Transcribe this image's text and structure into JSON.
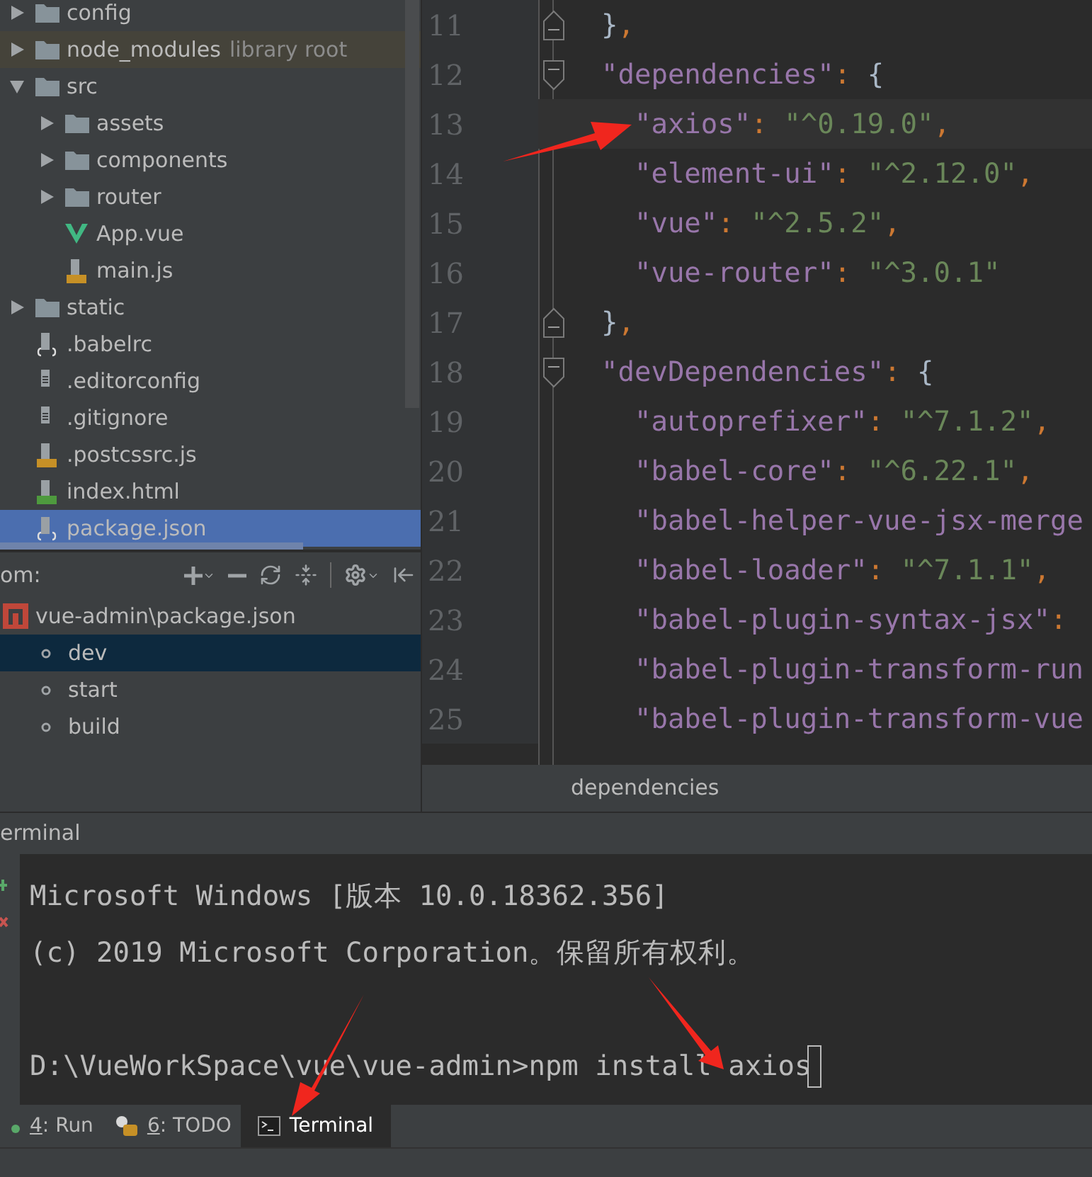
{
  "project_tree": [
    {
      "name": "config",
      "kind": "folder",
      "expanded": false,
      "selected": false
    },
    {
      "name": "node_modules",
      "note": "library root",
      "kind": "folder",
      "expanded": false,
      "selected": false
    },
    {
      "name": "src",
      "kind": "folder",
      "expanded": true,
      "selected": false,
      "children": [
        {
          "name": "assets",
          "kind": "folder",
          "expanded": false,
          "selected": false
        },
        {
          "name": "components",
          "kind": "folder",
          "expanded": false,
          "selected": false
        },
        {
          "name": "router",
          "kind": "folder",
          "expanded": false,
          "selected": false
        },
        {
          "name": "App.vue",
          "kind": "vue",
          "selected": false
        },
        {
          "name": "main.js",
          "kind": "js",
          "selected": false
        }
      ]
    },
    {
      "name": "static",
      "kind": "folder",
      "expanded": false,
      "selected": false
    },
    {
      "name": ".babelrc",
      "kind": "json",
      "selected": false
    },
    {
      "name": ".editorconfig",
      "kind": "text",
      "selected": false
    },
    {
      "name": ".gitignore",
      "kind": "text",
      "selected": false
    },
    {
      "name": ".postcssrc.js",
      "kind": "js",
      "selected": false
    },
    {
      "name": "index.html",
      "kind": "html",
      "selected": false
    },
    {
      "name": "package.json",
      "kind": "json",
      "selected": true
    }
  ],
  "npm_panel": {
    "title": "om:",
    "package": "vue-admin\\package.json",
    "scripts": [
      {
        "name": "dev",
        "selected": true
      },
      {
        "name": "start",
        "selected": false
      },
      {
        "name": "build",
        "selected": false
      }
    ]
  },
  "editor": {
    "lines": [
      {
        "number": "11",
        "current": false,
        "kind": "block_end",
        "parts": [
          {
            "kind": "brace",
            "text": "  }"
          },
          {
            "kind": "sep",
            "text": ","
          }
        ]
      },
      {
        "number": "12",
        "current": false,
        "kind": "block_start",
        "parts": [
          {
            "kind": "key",
            "text": "  \"dependencies\""
          },
          {
            "kind": "sep",
            "text": ": "
          },
          {
            "kind": "brace",
            "text": "{"
          }
        ]
      },
      {
        "number": "13",
        "current": true,
        "parts": [
          {
            "kind": "key",
            "text": "    \"axios\""
          },
          {
            "kind": "sep",
            "text": ": "
          },
          {
            "kind": "string",
            "text": "\"^0.19.0\""
          },
          {
            "kind": "sep",
            "text": ","
          }
        ]
      },
      {
        "number": "14",
        "current": false,
        "parts": [
          {
            "kind": "key",
            "text": "    \"element-ui\""
          },
          {
            "kind": "sep",
            "text": ": "
          },
          {
            "kind": "string",
            "text": "\"^2.12.0\""
          },
          {
            "kind": "sep",
            "text": ","
          }
        ]
      },
      {
        "number": "15",
        "current": false,
        "parts": [
          {
            "kind": "key",
            "text": "    \"vue\""
          },
          {
            "kind": "sep",
            "text": ": "
          },
          {
            "kind": "string",
            "text": "\"^2.5.2\""
          },
          {
            "kind": "sep",
            "text": ","
          }
        ]
      },
      {
        "number": "16",
        "current": false,
        "parts": [
          {
            "kind": "key",
            "text": "    \"vue-router\""
          },
          {
            "kind": "sep",
            "text": ": "
          },
          {
            "kind": "string",
            "text": "\"^3.0.1\""
          }
        ]
      },
      {
        "number": "17",
        "current": false,
        "kind": "block_end",
        "parts": [
          {
            "kind": "brace",
            "text": "  }"
          },
          {
            "kind": "sep",
            "text": ","
          }
        ]
      },
      {
        "number": "18",
        "current": false,
        "kind": "block_start",
        "parts": [
          {
            "kind": "key",
            "text": "  \"devDependencies\""
          },
          {
            "kind": "sep",
            "text": ": "
          },
          {
            "kind": "brace",
            "text": "{"
          }
        ]
      },
      {
        "number": "19",
        "current": false,
        "parts": [
          {
            "kind": "key",
            "text": "    \"autoprefixer\""
          },
          {
            "kind": "sep",
            "text": ": "
          },
          {
            "kind": "string",
            "text": "\"^7.1.2\""
          },
          {
            "kind": "sep",
            "text": ","
          }
        ]
      },
      {
        "number": "20",
        "current": false,
        "parts": [
          {
            "kind": "key",
            "text": "    \"babel-core\""
          },
          {
            "kind": "sep",
            "text": ": "
          },
          {
            "kind": "string",
            "text": "\"^6.22.1\""
          },
          {
            "kind": "sep",
            "text": ","
          }
        ]
      },
      {
        "number": "21",
        "current": false,
        "parts": [
          {
            "kind": "key",
            "text": "    \"babel-helper-vue-jsx-merge"
          }
        ]
      },
      {
        "number": "22",
        "current": false,
        "parts": [
          {
            "kind": "key",
            "text": "    \"babel-loader\""
          },
          {
            "kind": "sep",
            "text": ": "
          },
          {
            "kind": "string",
            "text": "\"^7.1.1\""
          },
          {
            "kind": "sep",
            "text": ","
          }
        ]
      },
      {
        "number": "23",
        "current": false,
        "parts": [
          {
            "kind": "key",
            "text": "    \"babel-plugin-syntax-jsx\""
          },
          {
            "kind": "sep",
            "text": ":"
          }
        ]
      },
      {
        "number": "24",
        "current": false,
        "parts": [
          {
            "kind": "key",
            "text": "    \"babel-plugin-transform-run"
          }
        ]
      },
      {
        "number": "25",
        "current": false,
        "parts": [
          {
            "kind": "key",
            "text": "    \"babel-plugin-transform-vue"
          }
        ]
      }
    ],
    "breadcrumb": "dependencies"
  },
  "terminal": {
    "title": "erminal",
    "output": [
      "Microsoft Windows [版本 10.0.18362.356]",
      "(c) 2019 Microsoft Corporation。保留所有权利。"
    ],
    "command_line": "D:\\VueWorkSpace\\vue\\vue-admin>npm install axios"
  },
  "tool_tabs": [
    {
      "kind": "run",
      "label": "4: Run",
      "selected": false
    },
    {
      "kind": "todo",
      "label": "6: TODO",
      "selected": false
    },
    {
      "kind": "terminal",
      "label": "Terminal",
      "selected": true
    }
  ]
}
